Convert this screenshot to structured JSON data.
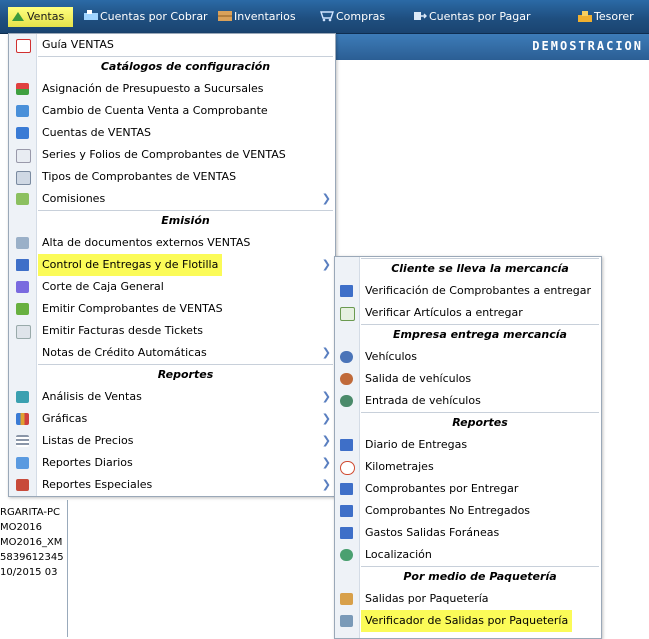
{
  "topbar": {
    "items": [
      {
        "label": "Ventas",
        "icon": "ventas-icon"
      },
      {
        "label": "Cuentas por Cobrar",
        "icon": "cuentas-cobrar-icon"
      },
      {
        "label": "Inventarios",
        "icon": "inventarios-icon"
      },
      {
        "label": "Compras",
        "icon": "compras-icon"
      },
      {
        "label": "Cuentas por Pagar",
        "icon": "cuentas-pagar-icon"
      },
      {
        "label": "Tesorer",
        "icon": "tesoreria-icon"
      }
    ]
  },
  "page": {
    "title": "DEMOSTRACION"
  },
  "background_fragments": [
    "RGARITA-PC",
    "MO2016",
    "MO2016_XM",
    "5839612345",
    "10/2015  03"
  ],
  "ventas_menu": {
    "items": [
      {
        "label": "Guía VENTAS",
        "icon": "pdf-icon"
      },
      {
        "header": "Catálogos de configuración"
      },
      {
        "label": "Asignación de Presupuesto a Sucursales",
        "icon": "budget-icon"
      },
      {
        "label": "Cambio de Cuenta Venta a Comprobante",
        "icon": "exchange-icon"
      },
      {
        "label": "Cuentas de VENTAS",
        "icon": "window-icon"
      },
      {
        "label": "Series y Folios de Comprobantes de VENTAS",
        "icon": "copy-icon"
      },
      {
        "label": "Tipos de Comprobantes de VENTAS",
        "icon": "document-type-icon"
      },
      {
        "label": "Comisiones",
        "icon": "pencil-icon",
        "submenu": true
      },
      {
        "header": "Emisión"
      },
      {
        "label": "Alta de documentos externos VENTAS",
        "icon": "add-document-icon"
      },
      {
        "label": "Control de Entregas y de Flotilla",
        "icon": "truck-icon",
        "submenu": true,
        "highlighted": true
      },
      {
        "label": "Corte de Caja General",
        "icon": "cash-icon"
      },
      {
        "label": "Emitir Comprobantes de VENTAS",
        "icon": "invoice-icon"
      },
      {
        "label": "Emitir Facturas desde Tickets",
        "icon": "ticket-icon"
      },
      {
        "label": "Notas de Crédito Automáticas",
        "icon": "",
        "submenu": true
      },
      {
        "header": "Reportes"
      },
      {
        "label": "Análisis de Ventas",
        "icon": "analysis-icon",
        "submenu": true
      },
      {
        "label": "Gráficas",
        "icon": "bar-chart-icon",
        "submenu": true
      },
      {
        "label": "Listas de Precios",
        "icon": "list-icon",
        "submenu": true
      },
      {
        "label": "Reportes Diarios",
        "icon": "daily-report-icon",
        "submenu": true
      },
      {
        "label": "Reportes Especiales",
        "icon": "special-report-icon",
        "submenu": true
      }
    ]
  },
  "entregas_menu": {
    "items": [
      {
        "header": "Cliente se lleva la mercancía"
      },
      {
        "label": "Verificación de Comprobantes a entregar",
        "icon": "truck-icon"
      },
      {
        "label": "Verificar Artículos a entregar",
        "icon": "play-icon"
      },
      {
        "header": "Empresa entrega mercancía"
      },
      {
        "label": "Vehículos",
        "icon": "car-icon"
      },
      {
        "label": "Salida de vehículos",
        "icon": "car-out-icon"
      },
      {
        "label": "Entrada de vehículos",
        "icon": "car-in-icon"
      },
      {
        "header": "Reportes"
      },
      {
        "label": "Diario de Entregas",
        "icon": "truck-icon"
      },
      {
        "label": "Kilometrajes",
        "icon": "speedometer-icon"
      },
      {
        "label": "Comprobantes por Entregar",
        "icon": "truck-icon"
      },
      {
        "label": "Comprobantes No Entregados",
        "icon": "truck-icon"
      },
      {
        "label": "Gastos Salidas Foráneas",
        "icon": "truck-icon"
      },
      {
        "label": "Localización",
        "icon": "globe-icon"
      },
      {
        "header": "Por medio de Paquetería"
      },
      {
        "label": "Salidas por Paquetería",
        "icon": "package-icon"
      },
      {
        "label": "Verificador de Salidas por Paquetería",
        "icon": "verify-package-icon",
        "highlighted": true
      }
    ]
  },
  "colors": {
    "highlight": "#fbfb58",
    "topbar": "#1f4f80",
    "submenu_arrow": "#5a7fc0"
  }
}
